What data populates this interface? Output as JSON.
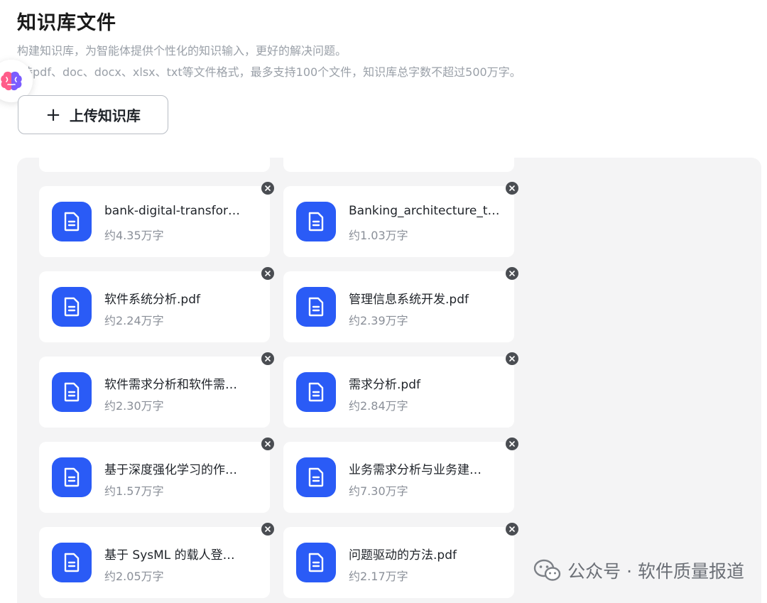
{
  "header": {
    "title": "知识库文件",
    "description_line1": "构建知识库，为智能体提供个性化的知识输入，更好的解决问题。",
    "description_line2": "持pdf、doc、docx、xlsx、txt等文件格式，最多支持100个文件，知识库总字数不超过500万字。"
  },
  "upload_button": {
    "plus": "+",
    "label": "上传知识库"
  },
  "files": [
    {
      "name": "bank-digital-transformation.pdf",
      "display_name": "bank-digital-transfor…",
      "size": "约4.35万字"
    },
    {
      "name": "Banking_architecture_t…",
      "display_name": "Banking_architecture_t…",
      "size": "约1.03万字"
    },
    {
      "name": "软件系统分析.pdf",
      "display_name": "软件系统分析.pdf",
      "size": "约2.24万字"
    },
    {
      "name": "管理信息系统开发.pdf",
      "display_name": "管理信息系统开发.pdf",
      "size": "约2.39万字"
    },
    {
      "name": "软件需求分析和软件需…",
      "display_name": "软件需求分析和软件需…",
      "size": "约2.30万字"
    },
    {
      "name": "需求分析.pdf",
      "display_name": "需求分析.pdf",
      "size": "约2.84万字"
    },
    {
      "name": "基于深度强化学习的作…",
      "display_name": "基于深度强化学习的作…",
      "size": "约1.57万字"
    },
    {
      "name": "业务需求分析与业务建…",
      "display_name": "业务需求分析与业务建…",
      "size": "约7.30万字"
    },
    {
      "name": "基于 SysML 的载人登…",
      "display_name": "基于 SysML 的载人登…",
      "size": "约2.05万字"
    },
    {
      "name": "问题驱动的方法.pdf",
      "display_name": "问题驱动的方法.pdf",
      "size": "约2.17万字"
    }
  ],
  "watermark": {
    "text": "公众号 · 软件质量报道"
  },
  "icons": {
    "file": "document-icon",
    "close": "close-icon",
    "brain": "brain-icon",
    "wechat": "wechat-icon"
  },
  "colors": {
    "accent": "#2a5bf6",
    "panel_bg": "#f4f4f5",
    "close_bg": "#4a4d52"
  }
}
